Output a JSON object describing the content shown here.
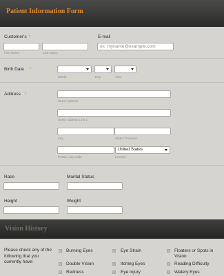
{
  "form_title": "Patient Information Form",
  "customer": {
    "label": "Customer's",
    "first_sub": "First Name",
    "last_sub": "Last Name",
    "first_value": "",
    "last_value": ""
  },
  "email": {
    "label": "E-mail",
    "placeholder": "ex: myname@example.com",
    "value": ""
  },
  "birth_date": {
    "label": "Birth Date",
    "month_sub": "Month",
    "day_sub": "Day",
    "year_sub": "Year",
    "month_value": "",
    "day_value": "",
    "year_value": ""
  },
  "address": {
    "label": "Address",
    "street_sub": "Street Address",
    "street2_sub": "Street Address Line 2",
    "city_sub": "City",
    "state_sub": "State / Province",
    "postal_sub": "Postal / Zip Code",
    "country_sub": "Country",
    "country_value": "United States"
  },
  "race": {
    "label": "Race",
    "value": ""
  },
  "marital_status": {
    "label": "Marital Status",
    "value": ""
  },
  "height": {
    "label": "Height",
    "value": ""
  },
  "weight": {
    "label": "Weight",
    "value": ""
  },
  "vision_section": {
    "title": "Vision History",
    "question": "Please check any of the following that you currently have:",
    "options": [
      "Burning Eyes",
      "Eye Strain",
      "Floaters or Spots in Vision",
      "Double Vision",
      "Itching Eyes",
      "Reading Difficulty",
      "Redness",
      "Eye Injury",
      "Watery Eyes"
    ]
  }
}
